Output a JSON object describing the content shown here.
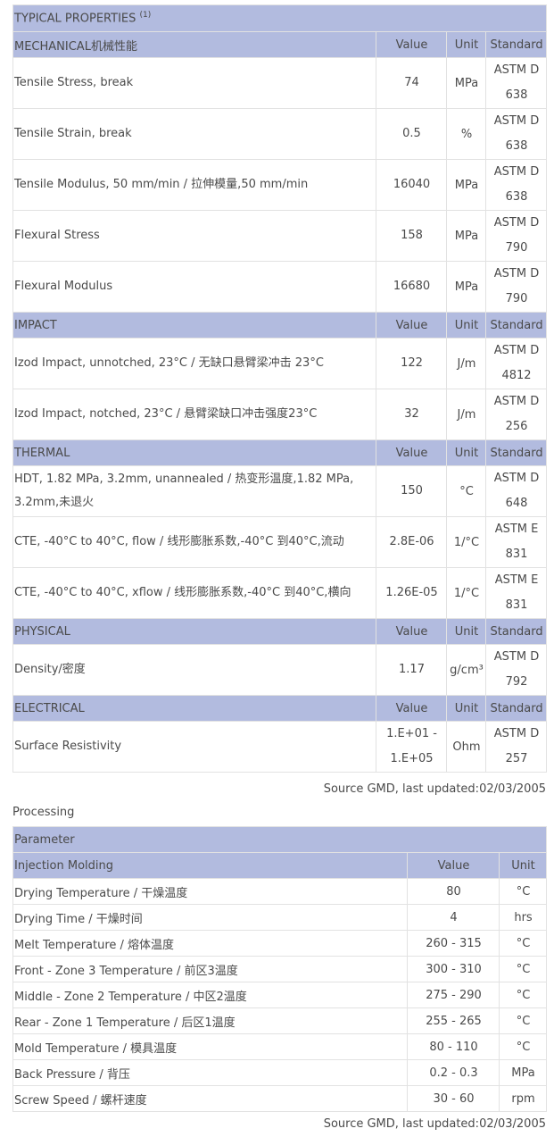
{
  "properties": {
    "title": "TYPICAL PROPERTIES",
    "title_note": "(1)",
    "col_value": "Value",
    "col_unit": "Unit",
    "col_standard": "Standard",
    "sections": [
      {
        "name": "MECHANICAL机械性能",
        "rows": [
          {
            "property": "Tensile Stress, break",
            "value": "74",
            "unit": "MPa",
            "standard": "ASTM D 638"
          },
          {
            "property": "Tensile Strain, break",
            "value": "0.5",
            "unit": "%",
            "standard": "ASTM D 638"
          },
          {
            "property": "Tensile Modulus, 50 mm/min / 拉伸模量,50 mm/min",
            "value": "16040",
            "unit": "MPa",
            "standard": "ASTM D 638"
          },
          {
            "property": "Flexural Stress",
            "value": "158",
            "unit": "MPa",
            "standard": "ASTM D 790"
          },
          {
            "property": "Flexural Modulus",
            "value": "16680",
            "unit": "MPa",
            "standard": "ASTM D 790"
          }
        ]
      },
      {
        "name": "IMPACT",
        "rows": [
          {
            "property": "Izod Impact, unnotched, 23°C / 无缺口悬臂梁冲击 23°C",
            "value": "122",
            "unit": "J/m",
            "standard": "ASTM D 4812"
          },
          {
            "property": "Izod Impact, notched, 23°C / 悬臂梁缺口冲击强度23°C",
            "value": "32",
            "unit": "J/m",
            "standard": "ASTM D 256"
          }
        ]
      },
      {
        "name": "THERMAL",
        "rows": [
          {
            "property": "HDT, 1.82 MPa, 3.2mm, unannealed / 热变形温度,1.82 MPa, 3.2mm,未退火",
            "value": "150",
            "unit": "°C",
            "standard": "ASTM D 648"
          },
          {
            "property": "CTE, -40°C to 40°C, flow / 线形膨胀系数,-40°C 到40°C,流动",
            "value": "2.8E-06",
            "unit": "1/°C",
            "standard": "ASTM E 831"
          },
          {
            "property": "CTE, -40°C to 40°C, xflow / 线形膨胀系数,-40°C 到40°C,横向",
            "value": "1.26E-05",
            "unit": "1/°C",
            "standard": "ASTM E 831"
          }
        ]
      },
      {
        "name": "PHYSICAL",
        "rows": [
          {
            "property": "Density/密度",
            "value": "1.17",
            "unit": "g/cm³",
            "standard": "ASTM D 792"
          }
        ]
      },
      {
        "name": "ELECTRICAL",
        "rows": [
          {
            "property": "Surface Resistivity",
            "value": "1.E+01 - 1.E+05",
            "unit": "Ohm",
            "standard": "ASTM D 257"
          }
        ]
      }
    ],
    "source": "Source GMD, last updated:02/03/2005"
  },
  "processing": {
    "label": "Processing",
    "param_header": "Parameter",
    "section": "Injection Molding",
    "col_value": "Value",
    "col_unit": "Unit",
    "rows": [
      {
        "parameter": "Drying Temperature / 干燥温度",
        "value": "80",
        "unit": "°C"
      },
      {
        "parameter": "Drying Time / 干燥时间",
        "value": "4",
        "unit": "hrs"
      },
      {
        "parameter": "Melt Temperature / 熔体温度",
        "value": "260 - 315",
        "unit": "°C"
      },
      {
        "parameter": "Front - Zone 3 Temperature / 前区3温度",
        "value": "300 - 310",
        "unit": "°C"
      },
      {
        "parameter": "Middle - Zone 2 Temperature / 中区2温度",
        "value": "275 - 290",
        "unit": "°C"
      },
      {
        "parameter": "Rear - Zone 1 Temperature / 后区1温度",
        "value": "255 - 265",
        "unit": "°C"
      },
      {
        "parameter": "Mold Temperature / 模具温度",
        "value": "80 - 110",
        "unit": "°C"
      },
      {
        "parameter": "Back Pressure / 背压",
        "value": "0.2 - 0.3",
        "unit": "MPa"
      },
      {
        "parameter": "Screw Speed / 螺杆速度",
        "value": "30 - 60",
        "unit": "rpm"
      }
    ],
    "source": "Source GMD, last updated:02/03/2005"
  }
}
